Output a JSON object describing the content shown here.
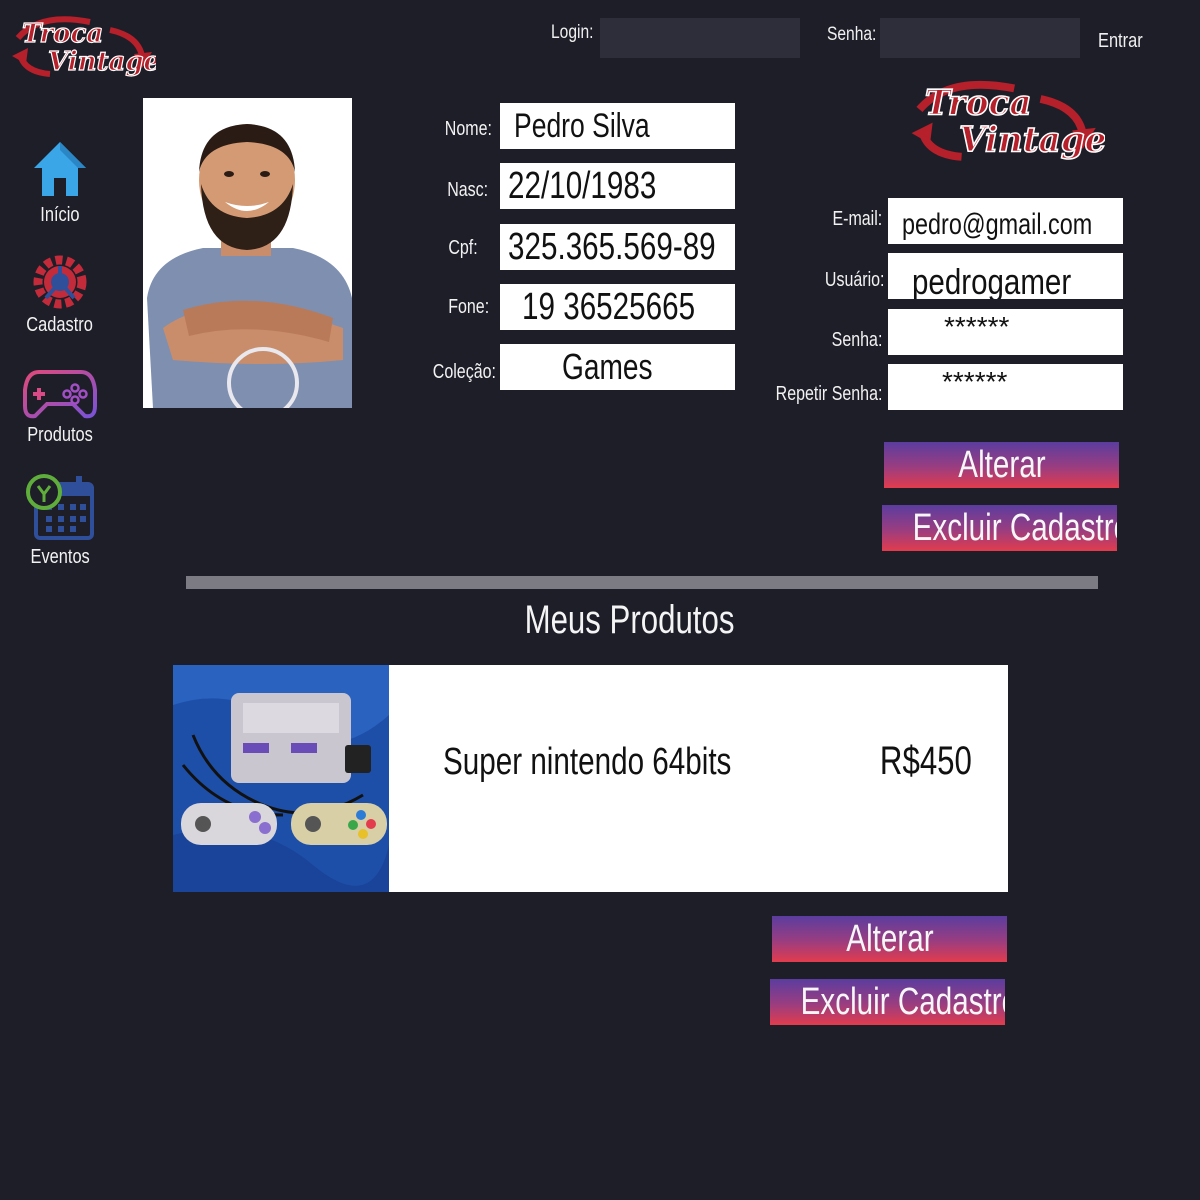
{
  "brand": {
    "logo_line1": "Troca",
    "logo_line2": "Vintage",
    "logo_color": "#b5202a"
  },
  "topbar": {
    "login_label": "Login:",
    "login_value": "",
    "password_label": "Senha:",
    "password_value": "",
    "enter_label": "Entrar"
  },
  "sidebar": {
    "items": [
      {
        "label": "Início",
        "icon": "home-icon"
      },
      {
        "label": "Cadastro",
        "icon": "gear-icon"
      },
      {
        "label": "Produtos",
        "icon": "gamepad-icon"
      },
      {
        "label": "Eventos",
        "icon": "calendar-icon"
      }
    ]
  },
  "profile": {
    "name_label": "Nome:",
    "name": "Pedro Silva",
    "birth_label": "Nasc:",
    "birth": "22/10/1983",
    "cpf_label": "Cpf:",
    "cpf": "325.365.569-89",
    "phone_label": "Fone:",
    "phone": "19 36525665",
    "collection_label": "Coleção:",
    "collection": "Games",
    "email_label": "E-mail:",
    "email": "pedro@gmail.com",
    "user_label": "Usuário:",
    "user": "pedrogamer",
    "password_label": "Senha:",
    "password": "******",
    "repeat_label": "Repetir Senha:",
    "repeat": "******",
    "alter_button": "Alterar",
    "delete_button": "Excluir Cadastro"
  },
  "products": {
    "title": "Meus Produtos",
    "items": [
      {
        "name": "Super nintendo 64bits",
        "price": "R$450"
      }
    ],
    "alter_button": "Alterar",
    "delete_button": "Excluir Cadastro"
  },
  "colors": {
    "background": "#1e1e29",
    "button_gradient_top": "#5b3d9e",
    "button_gradient_bottom": "#e23c4d",
    "divider": "#7c7b83"
  }
}
